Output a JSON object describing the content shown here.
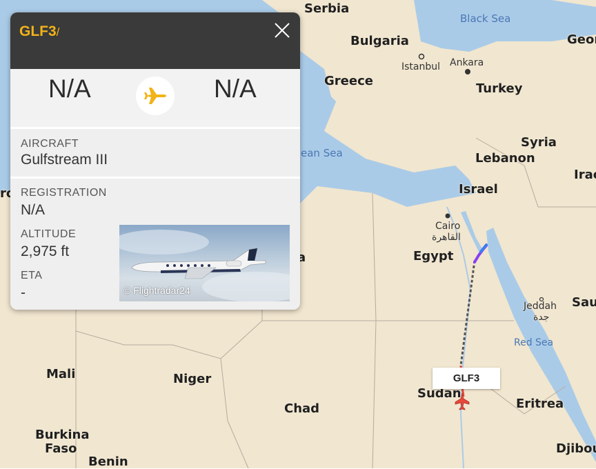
{
  "map": {
    "countries": [
      "Serbia",
      "Bulgaria",
      "Greece",
      "Turkey",
      "Syria",
      "Lebanon",
      "Israel",
      "Egypt",
      "Sudan",
      "Eritrea",
      "Mali",
      "Niger",
      "Chad",
      "Burkina Faso",
      "Benin",
      "Georgia",
      "Iraq",
      "Saudi Arabia",
      "Djibouti"
    ],
    "country_labels": {
      "serbia": "Serbia",
      "bulgaria": "Bulgaria",
      "greece": "Greece",
      "turkey": "Turkey",
      "syria": "Syria",
      "lebanon": "Lebanon",
      "israel": "Israel",
      "egypt": "Egypt",
      "sudan": "Sudan",
      "eritrea": "Eritrea",
      "mali": "Mali",
      "niger": "Niger",
      "chad": "Chad",
      "burkina": "Burkina",
      "faso": "Faso",
      "benin": "Benin",
      "georgia": "Geor",
      "iraq": "Irac",
      "saudi": "Sau",
      "djibouti": "Djibou",
      "ro": "ro",
      "a_frag": "a"
    },
    "water_labels": {
      "black_sea": "Black Sea",
      "med_sea": "ean Sea",
      "red_sea": "Red Sea"
    },
    "city_labels": {
      "istanbul": "Istanbul",
      "ankara": "Ankara",
      "cairo": "Cairo",
      "cairo_ar": "القاهرة",
      "jeddah": "Jeddah",
      "jeddah_ar": "جدة"
    },
    "flight_tag": "GLF3",
    "colors": {
      "land": "#f1e6cf",
      "water": "#aacbe8",
      "track_dashed": "#555555",
      "plane": "#e8493b"
    }
  },
  "panel": {
    "callsign": "GLF3",
    "callsign_suffix": "/",
    "close_icon": "close-icon",
    "origin": "N/A",
    "destination": "N/A",
    "plane_icon": "airplane-icon",
    "aircraft_label": "AIRCRAFT",
    "aircraft_value": "Gulfstream III",
    "registration_label": "REGISTRATION",
    "registration_value": "N/A",
    "altitude_label": "ALTITUDE",
    "altitude_value": "2,975 ft",
    "eta_label": "ETA",
    "eta_value": "-",
    "photo_credit": "© Flightradar24",
    "accent_color": "#f2b318"
  }
}
